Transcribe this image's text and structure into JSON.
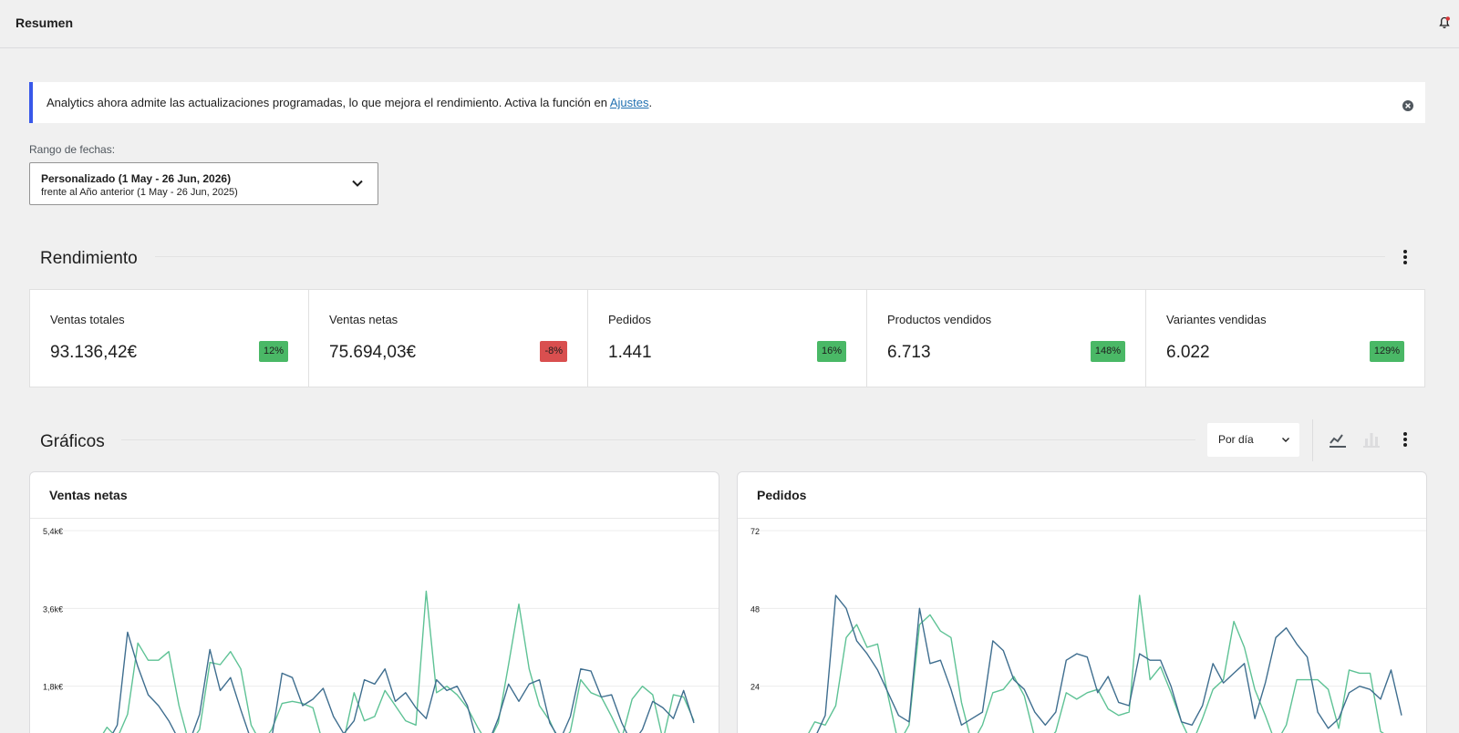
{
  "header": {
    "title": "Resumen",
    "bell_icon": "bell-icon"
  },
  "notice": {
    "text_before": "Analytics ahora admite las actualizaciones programadas, lo que mejora el rendimiento. Activa la función en ",
    "link_text": "Ajustes",
    "text_after": ".",
    "accent": "#3858e9"
  },
  "date_range": {
    "label": "Rango de fechas:",
    "primary": "Personalizado (1 May - 26 Jun, 2026)",
    "comparison": "frente al Año anterior (1 May - 26 Jun, 2025)"
  },
  "performance": {
    "title": "Rendimiento",
    "cards": [
      {
        "label": "Ventas totales",
        "value": "93.136,42€",
        "delta": "12%",
        "trend": "up"
      },
      {
        "label": "Ventas netas",
        "value": "75.694,03€",
        "delta": "-8%",
        "trend": "down"
      },
      {
        "label": "Pedidos",
        "value": "1.441",
        "delta": "16%",
        "trend": "up"
      },
      {
        "label": "Productos vendidos",
        "value": "6.713",
        "delta": "148%",
        "trend": "up"
      },
      {
        "label": "Variantes vendidas",
        "value": "6.022",
        "delta": "129%",
        "trend": "up"
      }
    ],
    "colors": {
      "up": "#4ab866",
      "down": "#d94f4f"
    }
  },
  "charts_section": {
    "title": "Gráficos",
    "interval": "Por día",
    "line_chart_icon": "line-chart-icon",
    "bar_chart_icon": "bar-chart-icon"
  },
  "chart_data": [
    {
      "type": "line",
      "title": "Ventas netas",
      "y_ticks": [
        "5,4k€",
        "3,6k€",
        "1,8k€"
      ],
      "ylim": [
        0,
        5400
      ],
      "series": [
        {
          "color": "#3f6e8f",
          "values": [
            300,
            350,
            900,
            3050,
            2250,
            1600,
            1350,
            1000,
            550,
            500,
            1150,
            2650,
            1700,
            2000,
            1250,
            550,
            500,
            600,
            2100,
            2000,
            1350,
            1500,
            1750,
            1100,
            700,
            1000,
            1950,
            1850,
            2200,
            1450,
            1650,
            1300,
            1050,
            1950,
            1700,
            1800,
            1350,
            350,
            400,
            1050,
            1850,
            1450,
            1850,
            1950,
            950,
            550,
            1100,
            2200,
            2150,
            1550,
            1600,
            950,
            350,
            800,
            1450,
            1300,
            1050,
            1700,
            950
          ]
        },
        {
          "color": "#5ec295",
          "values": [
            300,
            850,
            600,
            1150,
            2800,
            2400,
            2400,
            2600,
            1350,
            450,
            800,
            2350,
            2300,
            2600,
            2200,
            900,
            400,
            800,
            1400,
            1450,
            1400,
            1300,
            450,
            450,
            550,
            1650,
            1000,
            1100,
            1700,
            1350,
            1000,
            900,
            4000,
            1650,
            1800,
            1600,
            1300,
            850,
            300,
            950,
            2300,
            3700,
            2200,
            1350,
            1000,
            350,
            750,
            1950,
            1650,
            1550,
            1100,
            600,
            1500,
            1800,
            1600,
            550,
            1600,
            1550,
            1000
          ]
        }
      ]
    },
    {
      "type": "line",
      "title": "Pedidos",
      "y_ticks": [
        "72",
        "48",
        "24"
      ],
      "ylim": [
        0,
        72
      ],
      "series": [
        {
          "color": "#3f6e8f",
          "values": [
            4,
            8,
            15,
            52,
            48,
            38,
            34,
            29,
            22,
            15,
            13,
            48,
            31,
            32,
            23,
            12,
            14,
            16,
            38,
            35,
            26,
            23,
            16,
            12,
            16,
            32,
            34,
            33,
            22,
            27,
            19,
            18,
            34,
            32,
            32,
            24,
            13,
            12,
            18,
            31,
            25,
            28,
            31,
            14,
            25,
            39,
            42,
            37,
            33,
            16,
            11,
            14,
            22,
            24,
            23,
            20,
            29,
            15
          ]
        },
        {
          "color": "#5ec295",
          "values": [
            7,
            13,
            12,
            18,
            39,
            43,
            36,
            37,
            21,
            6,
            12,
            43,
            46,
            41,
            39,
            19,
            5,
            12,
            22,
            23,
            27,
            21,
            8,
            5,
            10,
            22,
            20,
            22,
            23,
            17,
            15,
            16,
            52,
            26,
            30,
            22,
            13,
            6,
            14,
            23,
            26,
            44,
            36,
            23,
            15,
            5,
            12,
            26,
            26,
            26,
            23,
            11,
            29,
            28,
            28,
            10,
            8,
            4
          ]
        }
      ]
    }
  ]
}
